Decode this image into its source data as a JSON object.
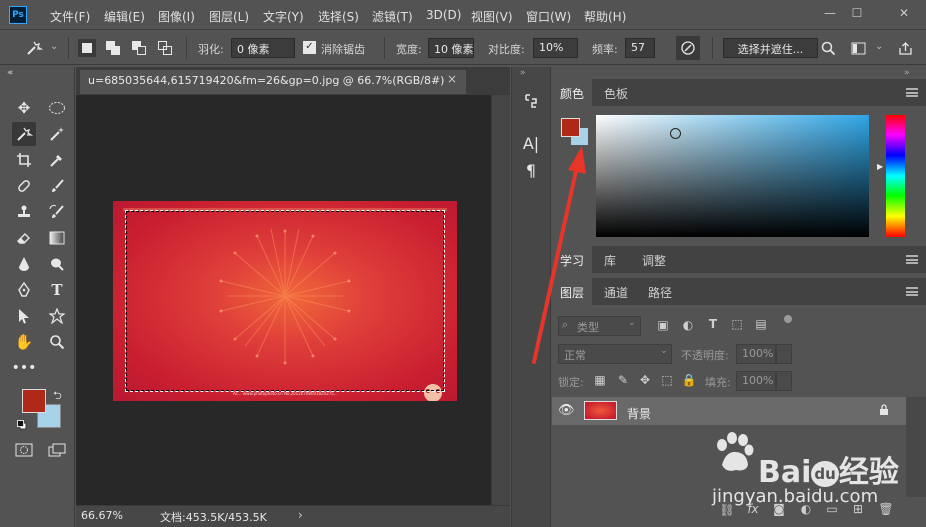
{
  "app": {
    "logo": "Ps"
  },
  "menubar": {
    "items": [
      "文件(F)",
      "编辑(E)",
      "图像(I)",
      "图层(L)",
      "文字(Y)",
      "选择(S)",
      "滤镜(T)",
      "3D(D)",
      "视图(V)",
      "窗口(W)",
      "帮助(H)"
    ],
    "window_controls": [
      "—",
      "☐",
      "✕"
    ]
  },
  "options": {
    "feather_label": "羽化:",
    "feather_value": "0 像素",
    "antialias_label": "消除锯齿",
    "antialias_checked": true,
    "width_label": "宽度:",
    "width_value": "10 像素",
    "contrast_label": "对比度:",
    "contrast_value": "10%",
    "frequency_label": "频率:",
    "frequency_value": "57",
    "select_mask_button": "选择并遮住..."
  },
  "document": {
    "tab_title": "u=685035644,615719420&fm=26&gp=0.jpg @ 66.7%(RGB/8#)",
    "close": "×",
    "zoom": "66.67%",
    "doc_info": "文档:453.5K/453.5K",
    "status_arrow": "›",
    "image_footer_text": "Ac... www.photophoto.cn No.20120708001820275..."
  },
  "colors": {
    "foreground": "#b02818",
    "background": "#a8d2e8",
    "accent": "#31a8ff"
  },
  "panels": {
    "color_tabs": [
      "颜色",
      "色板"
    ],
    "learn_tabs": [
      "学习",
      "库",
      "调整"
    ],
    "layers_tabs": [
      "图层",
      "通道",
      "路径"
    ]
  },
  "layers": {
    "filter_label": "类型",
    "blend_mode": "正常",
    "opacity_label": "不透明度:",
    "opacity_value": "100%",
    "lock_label": "锁定:",
    "fill_label": "填充:",
    "fill_value": "100%",
    "items": [
      {
        "name": "背景",
        "visible": true,
        "locked": true
      }
    ]
  },
  "watermark": {
    "brand": "Bai",
    "brand_suffix": "du",
    "product": "经验",
    "url": "jingyan.baidu.com"
  }
}
